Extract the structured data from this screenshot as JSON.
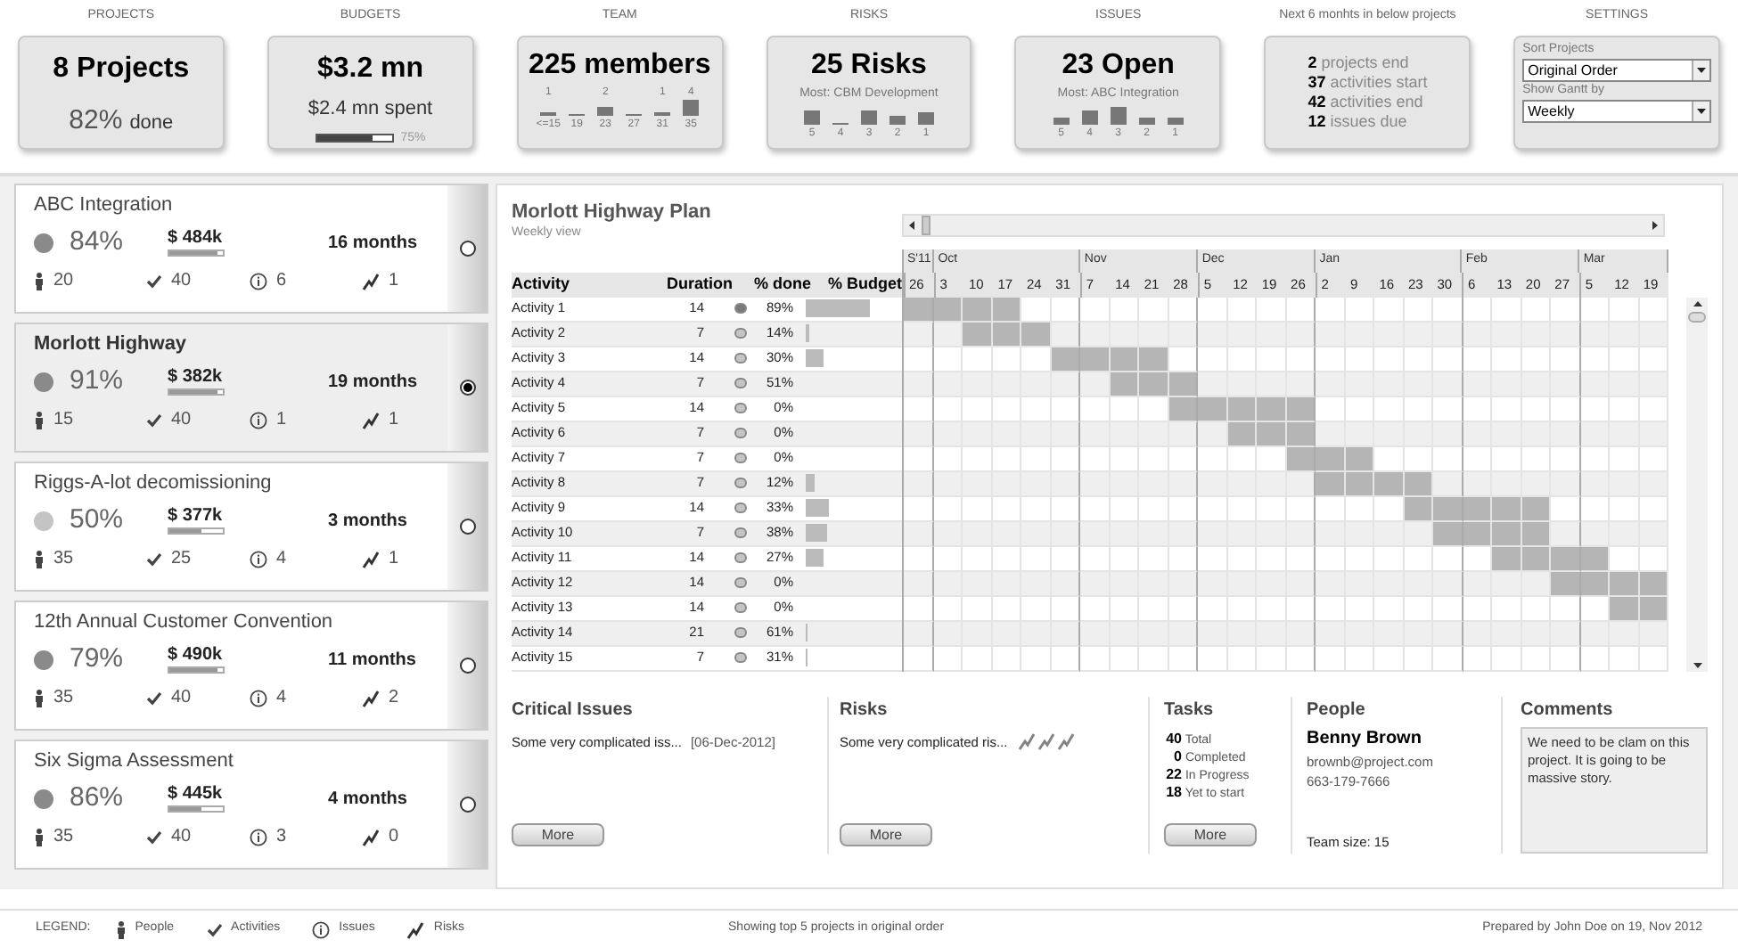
{
  "summary": [
    {
      "kind": "projects",
      "label": "PROJECTS",
      "title": "8 Projects",
      "percent": "82%",
      "suffix": "done"
    },
    {
      "kind": "budget",
      "label": "BUDGETS",
      "title": "$3.2 mn",
      "subtitle": "$2.4 mn spent",
      "level": 0.75,
      "reading": "75%"
    },
    {
      "kind": "histogram",
      "label": "TEAM",
      "title": "225 members",
      "bars": [
        {
          "count": "1",
          "axis": "<=15"
        },
        {
          "axis": "19"
        },
        {
          "count": "2",
          "axis": "23"
        },
        {
          "axis": "27"
        },
        {
          "count": "1",
          "axis": "31"
        },
        {
          "count": "4",
          "axis": "35"
        }
      ]
    },
    {
      "kind": "ranked",
      "label": "RISKS",
      "title": "25 Risks",
      "subtitle": "Most: CBM Development",
      "bars": [
        {
          "axis": "5"
        },
        {
          "axis": "4"
        },
        {
          "axis": "3"
        },
        {
          "axis": "2"
        },
        {
          "axis": "1"
        }
      ]
    },
    {
      "kind": "ranked",
      "label": "ISSUES",
      "title": "23 Open",
      "subtitle": "Most: ABC Integration",
      "bars": [
        {
          "axis": "5"
        },
        {
          "axis": "4"
        },
        {
          "axis": "3"
        },
        {
          "axis": "2"
        },
        {
          "axis": "1"
        }
      ]
    },
    {
      "kind": "list",
      "label": "Next 6 monhts in below projects",
      "lines": [
        {
          "number": "2",
          "text": "projects end"
        },
        {
          "number": "37",
          "text": "activities start"
        },
        {
          "number": "42",
          "text": "activities end"
        },
        {
          "number": "12",
          "text": "issues due"
        }
      ]
    },
    {
      "kind": "settings",
      "label": "SETTINGS",
      "selects": [
        {
          "label": "Sort Projects",
          "value": "Original Order"
        },
        {
          "label": "Show Gantt by",
          "value": "Weekly"
        }
      ]
    }
  ],
  "projects": [
    {
      "name": "ABC Integration",
      "color": "#8a8a8a",
      "percent": "84%",
      "budget": "$ 484k",
      "level": 0.9,
      "duration": "16 months",
      "people": "20",
      "activities": "40",
      "issues": "6",
      "risks": "1",
      "selected": false
    },
    {
      "name": "Morlott Highway",
      "color": "#8a8a8a",
      "percent": "91%",
      "budget": "$ 382k",
      "level": 0.9,
      "duration": "19 months",
      "people": "15",
      "activities": "40",
      "issues": "1",
      "risks": "1",
      "selected": true
    },
    {
      "name": "Riggs-A-lot decomissioning",
      "color": "#c4c4c4",
      "percent": "50%",
      "budget": "$ 377k",
      "level": 0.6,
      "duration": "3 months",
      "people": "35",
      "activities": "25",
      "issues": "4",
      "risks": "1",
      "selected": false
    },
    {
      "name": "12th Annual Customer Convention",
      "color": "#8a8a8a",
      "percent": "79%",
      "budget": "$ 490k",
      "level": 0.9,
      "duration": "11 months",
      "people": "35",
      "activities": "40",
      "issues": "4",
      "risks": "2",
      "selected": false
    },
    {
      "name": "Six Sigma Assessment",
      "color": "#8a8a8a",
      "percent": "86%",
      "budget": "$ 445k",
      "level": 0.6,
      "duration": "4 months",
      "people": "35",
      "activities": "40",
      "issues": "3",
      "risks": "0",
      "selected": false
    }
  ],
  "plan": {
    "title": "Morlott Highway Plan",
    "subtitle": "Weekly view",
    "columns": [
      "Activity",
      "Duration",
      "% done",
      "% Budget"
    ],
    "months": [
      {
        "label": "S'11",
        "weeks": [
          "26"
        ]
      },
      {
        "label": "Oct",
        "weeks": [
          "3",
          "10",
          "17",
          "24",
          "31"
        ]
      },
      {
        "label": "Nov",
        "weeks": [
          "7",
          "14",
          "21",
          "28"
        ]
      },
      {
        "label": "Dec",
        "weeks": [
          "5",
          "12",
          "19",
          "26"
        ]
      },
      {
        "label": "Jan",
        "weeks": [
          "2",
          "9",
          "16",
          "23",
          "30"
        ]
      },
      {
        "label": "Feb",
        "weeks": [
          "6",
          "13",
          "20",
          "27"
        ]
      },
      {
        "label": "Mar",
        "weeks": [
          "5",
          "12",
          "19"
        ]
      }
    ],
    "rows": [
      {
        "name": "Activity 1",
        "duration": "14",
        "color": "#7a7a7a",
        "done": "89%",
        "scheduled": [
          true,
          true,
          true,
          true,
          false,
          false,
          false,
          false,
          false,
          false,
          false,
          false,
          false,
          false,
          false,
          false,
          false,
          false,
          false,
          false,
          false,
          false,
          false,
          false,
          false,
          false
        ]
      },
      {
        "name": "Activity 2",
        "duration": "7",
        "color": "#c4c4c4",
        "done": "14%",
        "scheduled": [
          false,
          false,
          true,
          true,
          true,
          false,
          false,
          false,
          false,
          false,
          false,
          false,
          false,
          false,
          false,
          false,
          false,
          false,
          false,
          false,
          false,
          false,
          false,
          false,
          false,
          false
        ]
      },
      {
        "name": "Activity 3",
        "duration": "14",
        "color": "#c4c4c4",
        "done": "30%",
        "scheduled": [
          false,
          false,
          false,
          false,
          false,
          true,
          true,
          true,
          true,
          false,
          false,
          false,
          false,
          false,
          false,
          false,
          false,
          false,
          false,
          false,
          false,
          false,
          false,
          false,
          false,
          false
        ]
      },
      {
        "name": "Activity 4",
        "duration": "7",
        "color": "#c4c4c4",
        "done": "51%",
        "scheduled": [
          false,
          false,
          false,
          false,
          false,
          false,
          false,
          true,
          true,
          true,
          false,
          false,
          false,
          false,
          false,
          false,
          false,
          false,
          false,
          false,
          false,
          false,
          false,
          false,
          false,
          false
        ]
      },
      {
        "name": "Activity 5",
        "duration": "14",
        "color": "#c4c4c4",
        "done": "0%",
        "scheduled": [
          false,
          false,
          false,
          false,
          false,
          false,
          false,
          false,
          false,
          true,
          true,
          true,
          true,
          true,
          false,
          false,
          false,
          false,
          false,
          false,
          false,
          false,
          false,
          false,
          false,
          false
        ]
      },
      {
        "name": "Activity 6",
        "duration": "7",
        "color": "#c4c4c4",
        "done": "0%",
        "scheduled": [
          false,
          false,
          false,
          false,
          false,
          false,
          false,
          false,
          false,
          false,
          false,
          true,
          true,
          true,
          false,
          false,
          false,
          false,
          false,
          false,
          false,
          false,
          false,
          false,
          false,
          false
        ]
      },
      {
        "name": "Activity 7",
        "duration": "7",
        "color": "#c4c4c4",
        "done": "0%",
        "scheduled": [
          false,
          false,
          false,
          false,
          false,
          false,
          false,
          false,
          false,
          false,
          false,
          false,
          false,
          true,
          true,
          true,
          false,
          false,
          false,
          false,
          false,
          false,
          false,
          false,
          false,
          false
        ]
      },
      {
        "name": "Activity 8",
        "duration": "7",
        "color": "#c4c4c4",
        "done": "12%",
        "scheduled": [
          false,
          false,
          false,
          false,
          false,
          false,
          false,
          false,
          false,
          false,
          false,
          false,
          false,
          false,
          true,
          true,
          true,
          true,
          false,
          false,
          false,
          false,
          false,
          false,
          false,
          false
        ]
      },
      {
        "name": "Activity 9",
        "duration": "14",
        "color": "#c4c4c4",
        "done": "33%",
        "scheduled": [
          false,
          false,
          false,
          false,
          false,
          false,
          false,
          false,
          false,
          false,
          false,
          false,
          false,
          false,
          false,
          false,
          false,
          true,
          true,
          true,
          true,
          true,
          false,
          false,
          false,
          false
        ]
      },
      {
        "name": "Activity 10",
        "duration": "7",
        "color": "#c4c4c4",
        "done": "38%",
        "scheduled": [
          false,
          false,
          false,
          false,
          false,
          false,
          false,
          false,
          false,
          false,
          false,
          false,
          false,
          false,
          false,
          false,
          false,
          false,
          true,
          true,
          true,
          true,
          false,
          false,
          false,
          false
        ]
      },
      {
        "name": "Activity 11",
        "duration": "14",
        "color": "#c4c4c4",
        "done": "27%",
        "scheduled": [
          false,
          false,
          false,
          false,
          false,
          false,
          false,
          false,
          false,
          false,
          false,
          false,
          false,
          false,
          false,
          false,
          false,
          false,
          false,
          false,
          true,
          true,
          true,
          true,
          false,
          false
        ]
      },
      {
        "name": "Activity 12",
        "duration": "14",
        "color": "#c4c4c4",
        "done": "0%",
        "scheduled": [
          false,
          false,
          false,
          false,
          false,
          false,
          false,
          false,
          false,
          false,
          false,
          false,
          false,
          false,
          false,
          false,
          false,
          false,
          false,
          false,
          false,
          false,
          true,
          true,
          true,
          true
        ]
      },
      {
        "name": "Activity 13",
        "duration": "14",
        "color": "#c4c4c4",
        "done": "0%",
        "scheduled": [
          false,
          false,
          false,
          false,
          false,
          false,
          false,
          false,
          false,
          false,
          false,
          false,
          false,
          false,
          false,
          false,
          false,
          false,
          false,
          false,
          false,
          false,
          false,
          false,
          true,
          true
        ]
      },
      {
        "name": "Activity 14",
        "duration": "21",
        "color": "#c4c4c4",
        "done": "61%",
        "scheduled": [
          false,
          false,
          false,
          false,
          false,
          false,
          false,
          false,
          false,
          false,
          false,
          false,
          false,
          false,
          false,
          false,
          false,
          false,
          false,
          false,
          false,
          false,
          false,
          false,
          false,
          false
        ]
      },
      {
        "name": "Activity 15",
        "duration": "7",
        "color": "#c4c4c4",
        "done": "31%",
        "scheduled": [
          false,
          false,
          false,
          false,
          false,
          false,
          false,
          false,
          false,
          false,
          false,
          false,
          false,
          false,
          false,
          false,
          false,
          false,
          false,
          false,
          false,
          false,
          false,
          false,
          false,
          false
        ]
      }
    ]
  },
  "details": {
    "critical_issues": {
      "title": "Critical Issues",
      "items": [
        {
          "text": "Some very complicated iss...",
          "date": "[06-Dec-2012]"
        }
      ],
      "button": "More"
    },
    "risks": {
      "title": "Risks",
      "items": [
        {
          "text": "Some very complicated ris..."
        }
      ],
      "button": "More"
    },
    "tasks": {
      "title": "Tasks",
      "lines": [
        {
          "number": "40",
          "text": "Total"
        },
        {
          "number": "0",
          "text": "Completed"
        },
        {
          "number": "22",
          "text": "In Progress"
        },
        {
          "number": "18",
          "text": "Yet to start"
        }
      ],
      "button": "More"
    },
    "people": {
      "title": "People",
      "name": "Benny Brown",
      "email": "brownb@project.com",
      "phone": "663-179-7666",
      "team_size": "Team size: 15"
    },
    "comments": {
      "title": "Comments",
      "text": "We need to be clam on this project. It is going to be massive story."
    }
  },
  "footer": {
    "legend_label": "LEGEND:",
    "legend": [
      {
        "kind": "people",
        "text": "People"
      },
      {
        "kind": "activities",
        "text": "Activities"
      },
      {
        "kind": "issues",
        "text": "Issues"
      },
      {
        "kind": "risks",
        "text": "Risks"
      }
    ],
    "center": "Showing top 5 projects in original order",
    "right": "Prepared by John Doe on 19, Nov 2012"
  }
}
